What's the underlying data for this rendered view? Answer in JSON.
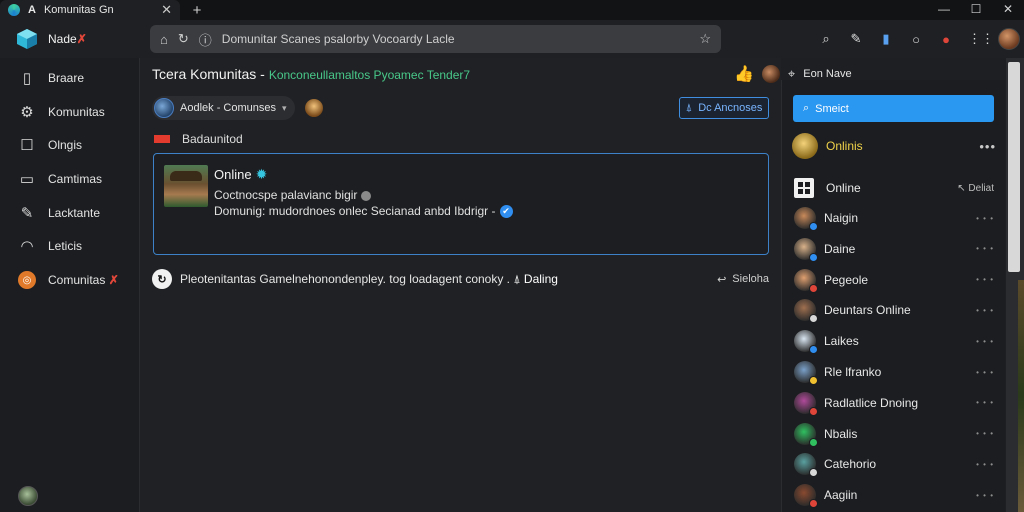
{
  "browser": {
    "tab_title": "Komunitas Gn",
    "tab_close": "✕",
    "new_tab": "+",
    "window_controls": [
      "—",
      "☐",
      "✕"
    ],
    "address": "Domunitar Scanes psalorby Vocoardy Lacle"
  },
  "brand": {
    "name": "Nade",
    "mark": "✗"
  },
  "sidebar": {
    "items": [
      {
        "label": "Braare",
        "icon": "building-icon"
      },
      {
        "label": "Komunitas",
        "icon": "gear-icon"
      },
      {
        "label": "Olngis",
        "icon": "square-icon"
      },
      {
        "label": "Camtimas",
        "icon": "monitor-icon"
      },
      {
        "label": "Lacktante",
        "icon": "pencil-icon"
      },
      {
        "label": "Leticis",
        "icon": "headphones-icon"
      },
      {
        "label": "Comunitas",
        "mark": "✗",
        "icon": "community-logo-icon"
      }
    ]
  },
  "main": {
    "title": "Tcera Komunitas -",
    "subtitle": "Konconeullamaltos Pyoamec Tender7",
    "header_right_label": "Eon Nave",
    "selector_label": "Aodlek - Comunses",
    "announce_button": "Dc Ancnoses",
    "bad_label": "Badaunitod",
    "card": {
      "status": "Online",
      "line1": "Coctnocspe palavianc bigir",
      "line2": "Domunig: mudordnoes onlec Secianad anbd Ibdrigr -"
    },
    "notice": {
      "text": "Pleotenitantas Gamelnehonondenpley. tog loadagent conoky .",
      "action": "Daling",
      "side": "Sieloha"
    }
  },
  "right_panel": {
    "search_label": "Smeict",
    "top_user": "Onlinis",
    "online_label": "Online",
    "online_action": "Deliat",
    "users": [
      {
        "name": "Naigin",
        "avatar_color": "#c98a5a",
        "badge_color": "#2f8ef0"
      },
      {
        "name": "Daine",
        "avatar_color": "#d9b28a",
        "badge_color": "#2f8ef0"
      },
      {
        "name": "Pegeole",
        "avatar_color": "#e0a070",
        "badge_color": "#e0453a"
      },
      {
        "name": "Deuntars Online",
        "avatar_color": "#a07050",
        "badge_color": "#d8d8d8"
      },
      {
        "name": "Laikes",
        "avatar_color": "#d9e6f2",
        "badge_color": "#2f8ef0"
      },
      {
        "name": "Rle lfranko",
        "avatar_color": "#7aa0c8",
        "badge_color": "#f0c030"
      },
      {
        "name": "Radlatlice Dnoing",
        "avatar_color": "#b04a9a",
        "badge_color": "#e0453a"
      },
      {
        "name": "Nbalis",
        "avatar_color": "#30c060",
        "badge_color": "#30c060"
      },
      {
        "name": "Catehorio",
        "avatar_color": "#5aa0a0",
        "badge_color": "#d8d8d8"
      },
      {
        "name": "Aagiin",
        "avatar_color": "#8a4a30",
        "badge_color": "#e0453a"
      }
    ]
  },
  "colors": {
    "accent": "#2a97f0",
    "online_green": "#49c88a",
    "warn": "#e33b2e",
    "gold": "#f0d24a"
  }
}
